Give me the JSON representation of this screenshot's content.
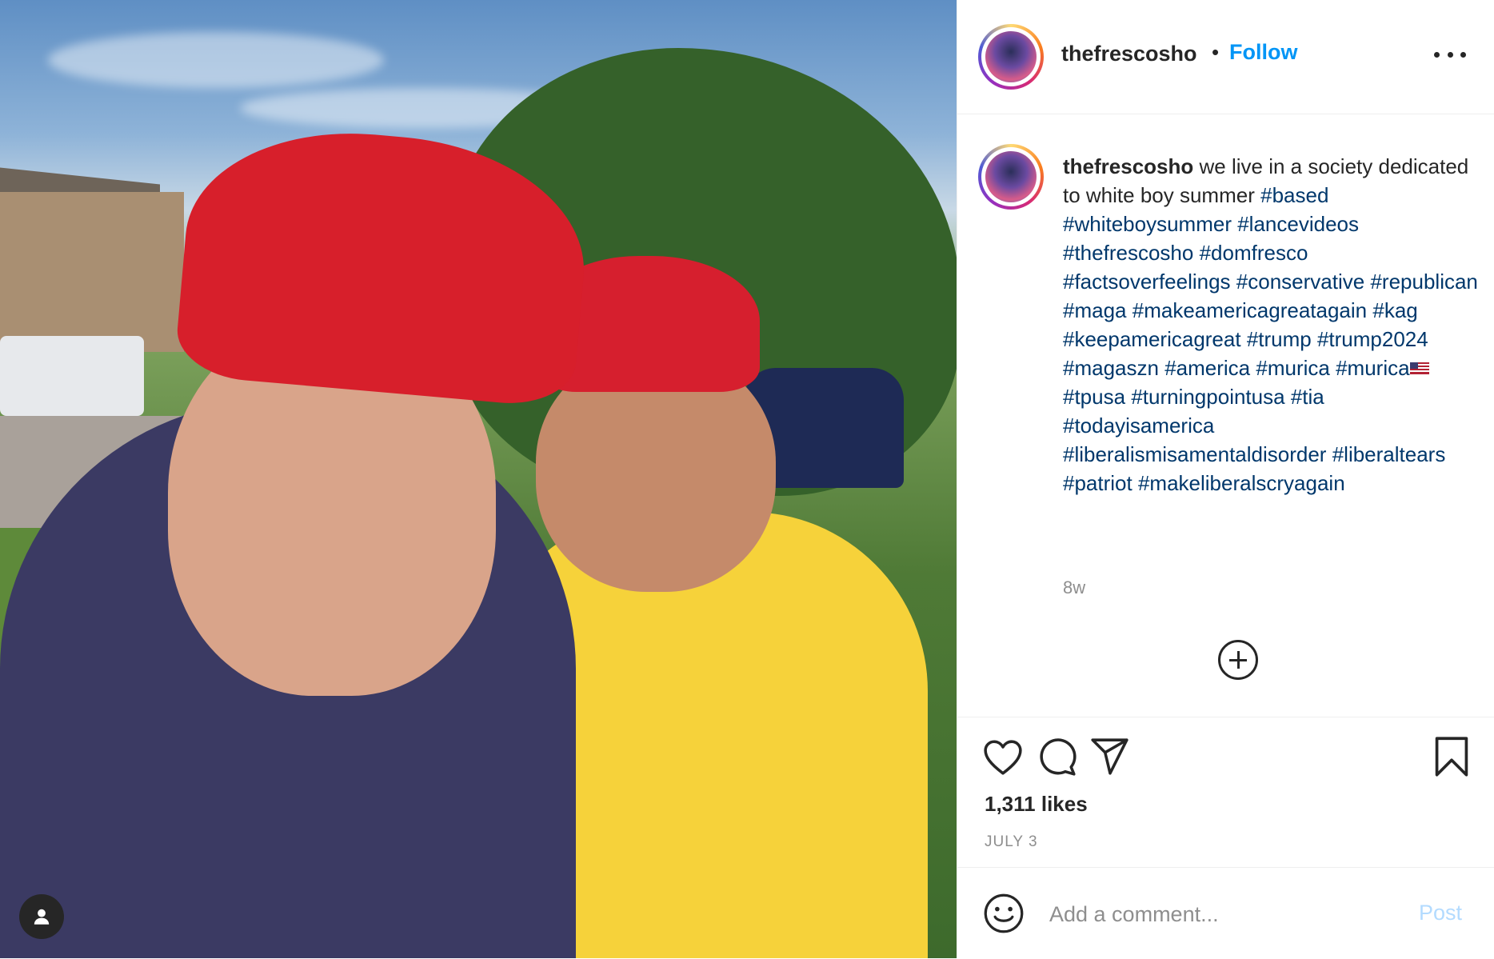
{
  "post": {
    "username": "thefrescosho",
    "separator": "•",
    "follow_label": "Follow",
    "caption_text": "we live in a society dedicated to white boy summer",
    "hashtags": [
      "#based",
      "#whiteboysummer",
      "#lancevideos",
      "#thefrescosho",
      "#domfresco",
      "#factsoverfeelings",
      "#conservative",
      "#republican",
      "#maga",
      "#makeamericagreatagain",
      "#kag",
      "#keepamericagreat",
      "#trump",
      "#trump2024",
      "#magaszn",
      "#america",
      "#murica",
      "#murica",
      "#tpusa",
      "#turningpointusa",
      "#tia",
      "#todayisamerica",
      "#liberalismisamentaldisorder",
      "#liberaltears",
      "#patriot",
      "#makeliberalscryagain"
    ],
    "age": "8w",
    "likes": "1,311 likes",
    "date": "JULY 3"
  },
  "comment": {
    "placeholder": "Add a comment...",
    "post_label": "Post"
  },
  "icons": {
    "like": "heart-icon",
    "comment": "comment-icon",
    "share": "send-icon",
    "save": "bookmark-icon",
    "emoji": "emoji-icon",
    "more": "more-options-icon",
    "load_more": "plus-circle-icon",
    "tagged_user": "user-icon"
  },
  "colors": {
    "accent": "#0095f6",
    "hashtag": "#00376b",
    "muted": "#8e8e8e",
    "post_disabled": "#b3dbff"
  }
}
